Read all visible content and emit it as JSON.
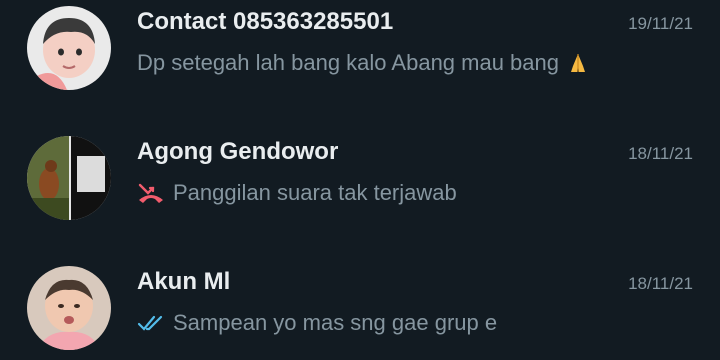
{
  "chats": [
    {
      "name": "Contact 085363285501",
      "date": "19/11/21",
      "preview": "Dp setegah lah bang kalo Abang mau bang",
      "preview_emoji": "folded-hands-emoji"
    },
    {
      "name": "Agong Gendowor",
      "date": "18/11/21",
      "preview": "Panggilan suara tak terjawab",
      "preview_icon": "missed-call-icon",
      "missed_call_color": "#f15c6d"
    },
    {
      "name": "Akun Ml",
      "date": "18/11/21",
      "preview": "Sampean yo mas sng gae grup e",
      "preview_icon": "double-check-read-icon",
      "read_tick_color": "#53bdeb"
    }
  ]
}
